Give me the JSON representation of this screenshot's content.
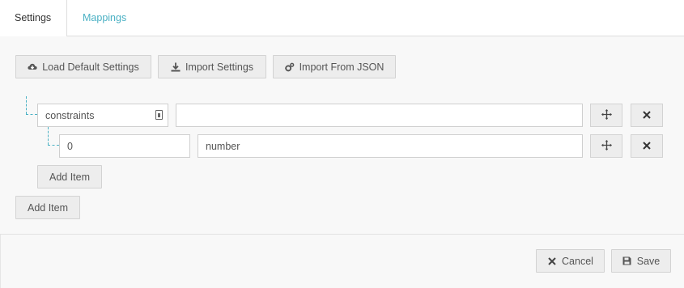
{
  "tabs": {
    "settings": "Settings",
    "mappings": "Mappings"
  },
  "toolbar": {
    "load_default": "Load Default Settings",
    "import_settings": "Import Settings",
    "import_json": "Import From JSON"
  },
  "tree": {
    "root": {
      "key": "constraints",
      "value": ""
    },
    "child": {
      "key": "0",
      "value": "number"
    },
    "add_item_inner": "Add Item",
    "add_item_outer": "Add Item"
  },
  "footer": {
    "cancel": "Cancel",
    "save": "Save"
  }
}
